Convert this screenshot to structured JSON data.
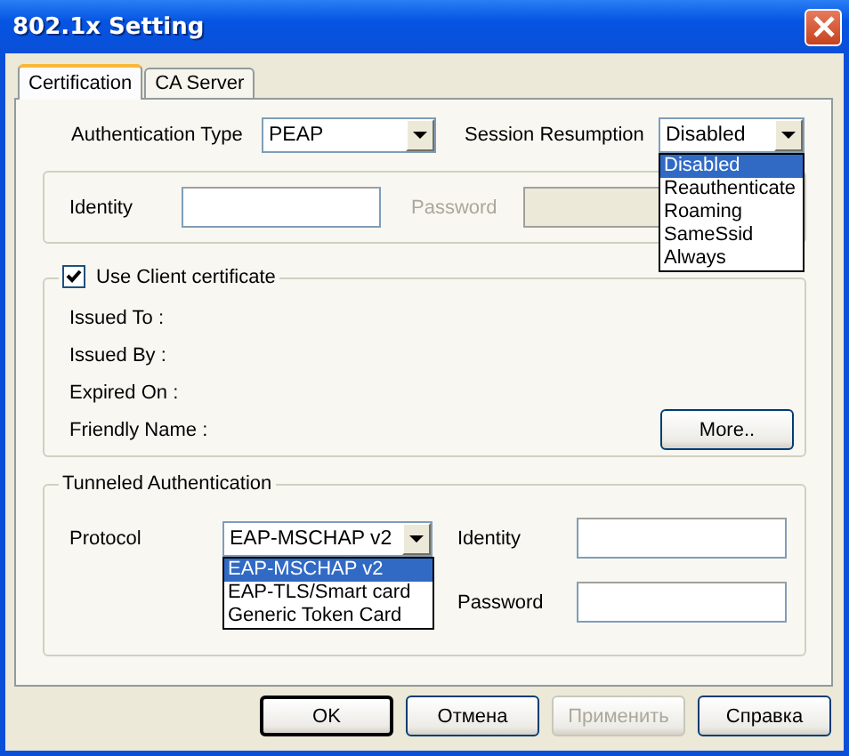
{
  "window": {
    "title": "802.1x Setting"
  },
  "tabs": [
    {
      "label": "Certification",
      "selected": true
    },
    {
      "label": "CA Server",
      "selected": false
    }
  ],
  "authentication_type": {
    "label": "Authentication Type",
    "value": "PEAP"
  },
  "session_resumption": {
    "label": "Session Resumption",
    "value": "Disabled",
    "expanded": true,
    "options": [
      {
        "label": "Disabled",
        "selected": true
      },
      {
        "label": "Reauthenticate",
        "selected": false
      },
      {
        "label": "Roaming",
        "selected": false
      },
      {
        "label": "SameSsid",
        "selected": false
      },
      {
        "label": "Always",
        "selected": false
      }
    ]
  },
  "credentials": {
    "identity_label": "Identity",
    "password_label": "Password",
    "password_disabled": true
  },
  "client_certificate": {
    "label": "Use Client certificate",
    "checked": true,
    "fields": [
      "Issued To :",
      "Issued By :",
      "Expired On :",
      "Friendly Name :"
    ],
    "more_button": "More.."
  },
  "tunneled": {
    "title": "Tunneled Authentication",
    "protocol_label": "Protocol",
    "protocol_value": "EAP-MSCHAP v2",
    "expanded": true,
    "options": [
      {
        "label": "EAP-MSCHAP v2",
        "selected": true
      },
      {
        "label": "EAP-TLS/Smart card",
        "selected": false
      },
      {
        "label": "Generic Token Card",
        "selected": false
      }
    ],
    "identity_label": "Identity",
    "password_label": "Password"
  },
  "buttons": [
    {
      "label": "OK",
      "default": true,
      "disabled": false
    },
    {
      "label": "Отмена",
      "default": false,
      "disabled": false
    },
    {
      "label": "Применить",
      "default": false,
      "disabled": true
    },
    {
      "label": "Справка",
      "default": false,
      "disabled": false
    }
  ]
}
